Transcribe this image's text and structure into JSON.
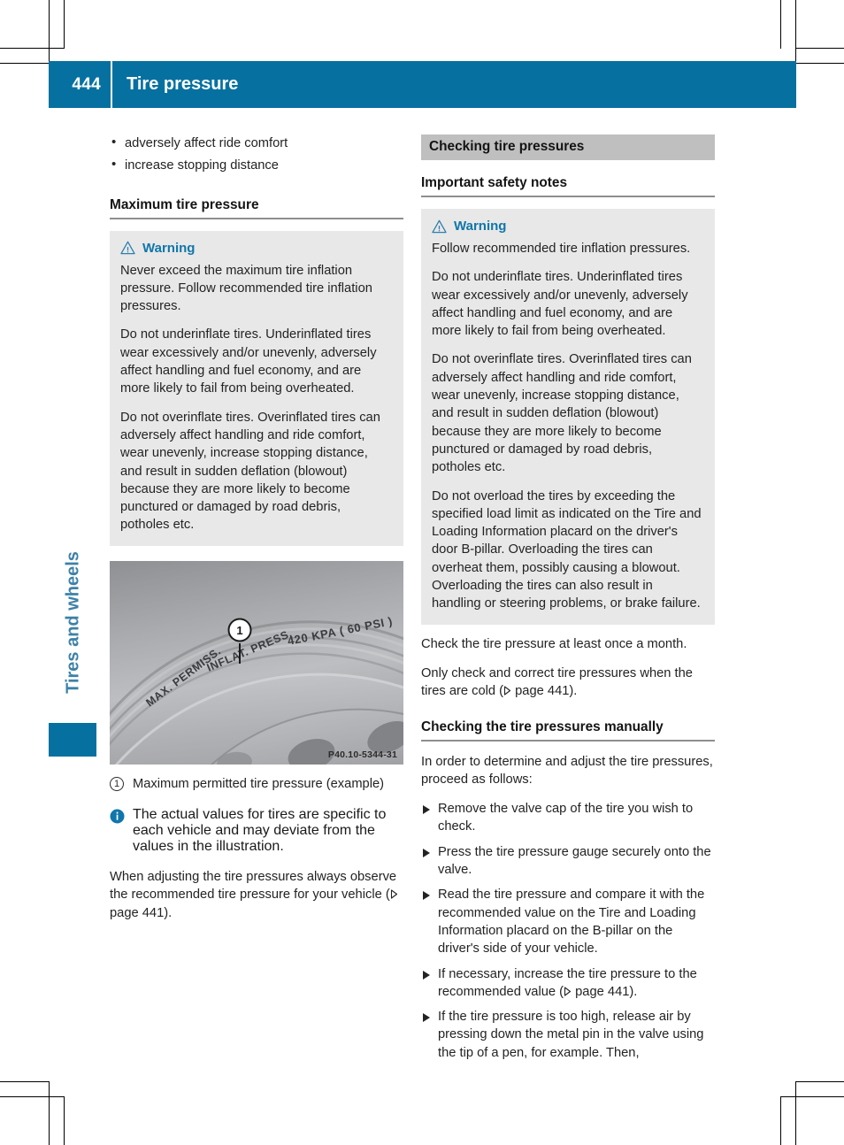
{
  "header": {
    "folio": "444",
    "title": "Tire pressure",
    "accent_color": "#0671a0"
  },
  "chapter_tab": {
    "label": "Tires and wheels",
    "label_color": "#3d81a8",
    "marker_color": "#0671a0"
  },
  "left_column": {
    "intro_bullets": [
      "adversely affect ride comfort",
      "increase stopping distance"
    ],
    "section_heading": "Maximum tire pressure",
    "warning": {
      "icon": "warning-triangle-icon",
      "title": "Warning",
      "paragraphs": [
        "Never exceed the maximum tire inflation pressure. Follow recommended tire inflation pressures.",
        "Do not underinflate tires. Underinflated tires wear excessively and/or unevenly, adversely affect handling and fuel economy, and are more likely to fail from being overheated.",
        "Do not overinflate tires. Overinflated tires can adversely affect handling and ride comfort, wear unevenly, increase stopping distance, and result in sudden deflation (blowout) because they are more likely to become punctured or damaged by road debris, potholes etc."
      ]
    },
    "figure": {
      "alt": "tire sidewall showing maximum permissible inflation pressure marking",
      "sidewall_text_line": "MAX. PERMISS. INFLAT. PRESS.",
      "sidewall_value": "420 KPA  ( 60 PSI )",
      "callout_number": "1",
      "image_code": "P40.10-5344-31"
    },
    "legend": [
      {
        "num": "1",
        "text": "Maximum permitted tire pressure (example)"
      }
    ],
    "info_note": {
      "icon": "info-circle-icon",
      "text": "The actual values for tires are specific to each vehicle and may deviate from the values in the illustration."
    },
    "closing_paragraph_a": "When adjusting the tire pressures always observe the recommended tire pressure for your vehicle (",
    "closing_xref": " page 441",
    "closing_paragraph_b": ")."
  },
  "right_column": {
    "band_heading": "Checking tire pressures",
    "section_heading": "Important safety notes",
    "warning": {
      "icon": "warning-triangle-icon",
      "title": "Warning",
      "paragraphs": [
        "Follow recommended tire inflation pressures.",
        "Do not underinflate tires. Underinflated tires wear excessively and/or unevenly, adversely affect handling and fuel economy, and are more likely to fail from being overheated.",
        "Do not overinflate tires. Overinflated tires can adversely affect handling and ride comfort, wear unevenly, increase stopping distance, and result in sudden deflation (blowout) because they are more likely to become punctured or damaged by road debris, potholes etc.",
        "Do not overload the tires by exceeding the specified load limit as indicated on the Tire and Loading Information placard on the driver's door B-pillar. Overloading the tires can overheat them, possibly causing a blowout. Overloading the tires can also result in handling or steering problems, or brake failure."
      ]
    },
    "after_warning_p1": "Check the tire pressure at least once a month.",
    "after_warning_p2_a": "Only check and correct tire pressures when the tires are cold (",
    "after_warning_xref": " page 441",
    "after_warning_p2_b": ").",
    "manual_heading": "Checking the tire pressures manually",
    "manual_intro": "In order to determine and adjust the tire pressures, proceed as follows:",
    "steps": [
      {
        "text": "Remove the valve cap of the tire you wish to check."
      },
      {
        "text": "Press the tire pressure gauge securely onto the valve."
      },
      {
        "text": "Read the tire pressure and compare it with the recommended value on the Tire and Loading Information placard on the B-pillar on the driver's side of your vehicle."
      },
      {
        "text_a": "If necessary, increase the tire pressure to the recommended value (",
        "xref": " page 441",
        "text_b": ")."
      },
      {
        "text": "If the tire pressure is too high, release air by pressing down the metal pin in the valve using the tip of a pen, for example. Then,"
      }
    ]
  }
}
